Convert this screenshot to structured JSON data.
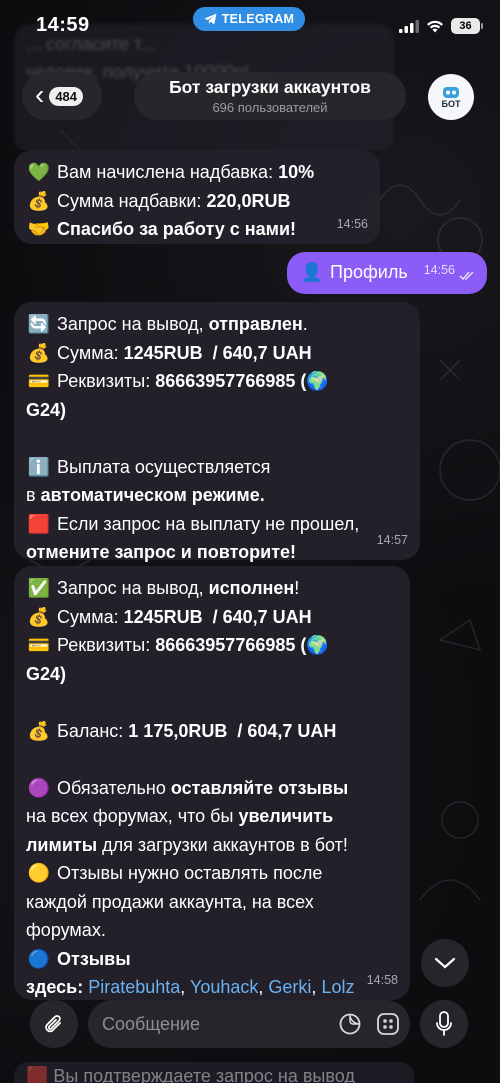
{
  "status_bar": {
    "time": "14:59",
    "app_pill": "TELEGRAM",
    "battery": "36"
  },
  "header": {
    "back_count": "484",
    "title": "Бот загрузки аккаунтов",
    "subtitle": "696 пользователей",
    "avatar_text": "БОТ"
  },
  "background_text": {
    "line1": "... согласите т...",
    "line2": "человек, получите 10000р! ..."
  },
  "messages": [
    {
      "type": "incoming",
      "lines": [
        {
          "emoji": "💚",
          "text": "Вам начислена надбавка: ",
          "bold": "10%"
        },
        {
          "emoji": "💰",
          "text": "Сумма надбавки: ",
          "bold": "220,0RUB"
        },
        {
          "emoji": "🤝",
          "text": "",
          "bold": "Спасибо за работу с нами!"
        }
      ],
      "time": "14:56"
    },
    {
      "type": "outgoing",
      "emoji": "👤",
      "text": "Профиль",
      "time": "14:56"
    },
    {
      "type": "incoming",
      "lines": [
        {
          "emoji": "🔄",
          "text": "Запрос на вывод, ",
          "bold": "отправлен",
          "after": "."
        },
        {
          "emoji": "💰",
          "text": "Сумма: ",
          "bold": "1245RUB  / 640,7 UAH"
        },
        {
          "emoji": "💳",
          "text": "Реквизиты: ",
          "bold": "86663957766985 (",
          "emoji2": "🌍"
        },
        {
          "text": "",
          "bold": "G24)"
        },
        {
          "text": ""
        },
        {
          "emoji": "ℹ️",
          "text": "Выплата осуществляется"
        },
        {
          "text": "в ",
          "bold": "автоматическом режиме."
        },
        {
          "emoji": "🟥",
          "text": "Если запрос на выплату не прошел,"
        },
        {
          "text": "",
          "bold": "отмените запрос и повторите!"
        }
      ],
      "time": "14:57"
    },
    {
      "type": "incoming",
      "lines": [
        {
          "emoji": "✅",
          "text": "Запрос на вывод, ",
          "bold": "исполнен",
          "after": "!"
        },
        {
          "emoji": "💰",
          "text": "Сумма: ",
          "bold": "1245RUB  / 640,7 UAH"
        },
        {
          "emoji": "💳",
          "text": "Реквизиты: ",
          "bold": "86663957766985 (",
          "emoji2": "🌍"
        },
        {
          "text": "",
          "bold": "G24)"
        },
        {
          "text": ""
        },
        {
          "emoji": "💰",
          "text": "Баланс: ",
          "bold": "1 175,0RUB  / 604,7 UAH"
        },
        {
          "text": ""
        },
        {
          "emoji": "🟣",
          "text": "Обязательно ",
          "bold": "оставляйте отзывы"
        },
        {
          "text": "на всех форумах, что бы ",
          "bold": "увеличить"
        },
        {
          "text": "",
          "bold": "лимиты",
          "after": " для загрузки аккаунтов в бот!"
        },
        {
          "emoji": "🟡",
          "text": "Отзывы нужно оставлять после"
        },
        {
          "text": "каждой продажи аккаунта, на всех"
        },
        {
          "text": "форумах."
        },
        {
          "emoji": "🔵",
          "text": "",
          "bold": "Отзывы"
        }
      ],
      "links_prefix": "здесь: ",
      "links": [
        "Piratebuhta",
        "Youhack",
        "Gerki",
        "Lolz"
      ],
      "time": "14:58"
    }
  ],
  "input": {
    "placeholder": "Сообщение"
  },
  "bottom_peek": "🟥 Вы подтверждаете запрос на вывод"
}
